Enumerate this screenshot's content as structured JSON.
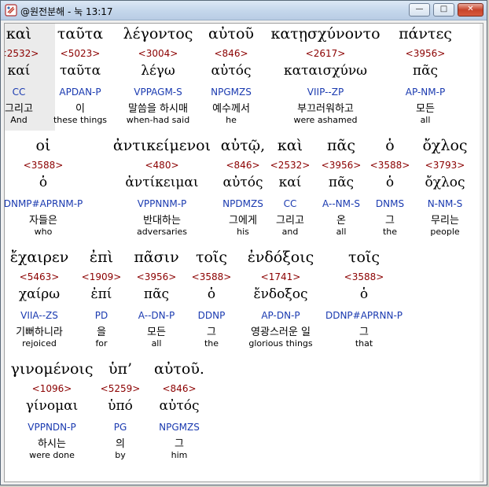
{
  "window": {
    "title": "@원전분해 - 눅 13:17"
  },
  "controls": {
    "minimize": "—",
    "maximize": "□",
    "close": "✕"
  },
  "rows": [
    {
      "words": [
        {
          "greek": "καὶ",
          "strong": "<2532>",
          "lemma": "καί",
          "parse": "CC",
          "korean": "그리고",
          "english": "And"
        },
        {
          "greek": "ταῦτα",
          "strong": "<5023>",
          "lemma": "ταῦτα",
          "parse": "APDAN-P",
          "korean": "이",
          "english": "these things"
        },
        {
          "greek": "λέγοντος",
          "strong": "<3004>",
          "lemma": "λέγω",
          "parse": "VPPAGM-S",
          "korean": "말씀을 하시매",
          "english": "when-had said"
        },
        {
          "greek": "αὐτοῦ",
          "strong": "<846>",
          "lemma": "αὐτός",
          "parse": "NPGMZS",
          "korean": "예수께서",
          "english": "he"
        },
        {
          "greek": "κατῃσχύνοντο",
          "strong": "<2617>",
          "lemma": "καταισχύνω",
          "parse": "VIIP--ZP",
          "korean": "부끄러워하고",
          "english": "were ashamed"
        },
        {
          "greek": "πάντες",
          "strong": "<3956>",
          "lemma": "πᾶς",
          "parse": "AP-NM-P",
          "korean": "모든",
          "english": "all"
        }
      ]
    },
    {
      "words": [
        {
          "greek": "οἱ",
          "strong": "<3588>",
          "lemma": "ὁ",
          "parse": "DNMP#APRNM-P",
          "korean": "자들은",
          "english": "who"
        },
        {
          "greek": "ἀντικείμενοι",
          "strong": "<480>",
          "lemma": "ἀντίκειμαι",
          "parse": "VPPNNM-P",
          "korean": "반대하는",
          "english": "adversaries"
        },
        {
          "greek": "αὐτῷ,",
          "strong": "<846>",
          "lemma": "αὐτός",
          "parse": "NPDMZS",
          "korean": "그에게",
          "english": "his"
        },
        {
          "greek": "καὶ",
          "strong": "<2532>",
          "lemma": "καί",
          "parse": "CC",
          "korean": "그리고",
          "english": "and"
        },
        {
          "greek": "πᾶς",
          "strong": "<3956>",
          "lemma": "πᾶς",
          "parse": "A--NM-S",
          "korean": "온",
          "english": "all"
        },
        {
          "greek": "ὁ",
          "strong": "<3588>",
          "lemma": "ὁ",
          "parse": "DNMS",
          "korean": "그",
          "english": "the"
        },
        {
          "greek": "ὄχλος",
          "strong": "<3793>",
          "lemma": "ὄχλος",
          "parse": "N-NM-S",
          "korean": "무리는",
          "english": "people"
        }
      ]
    },
    {
      "words": [
        {
          "greek": "ἔχαιρεν",
          "strong": "<5463>",
          "lemma": "χαίρω",
          "parse": "VIIA--ZS",
          "korean": "기뻐하니라",
          "english": "rejoiced"
        },
        {
          "greek": "ἐπὶ",
          "strong": "<1909>",
          "lemma": "ἐπί",
          "parse": "PD",
          "korean": "을",
          "english": "for"
        },
        {
          "greek": "πᾶσιν",
          "strong": "<3956>",
          "lemma": "πᾶς",
          "parse": "A--DN-P",
          "korean": "모든",
          "english": "all"
        },
        {
          "greek": "τοῖς",
          "strong": "<3588>",
          "lemma": "ὁ",
          "parse": "DDNP",
          "korean": "그",
          "english": "the"
        },
        {
          "greek": "ἐνδόξοις",
          "strong": "<1741>",
          "lemma": "ἔνδοξος",
          "parse": "AP-DN-P",
          "korean": "영광스러운 일",
          "english": "glorious things"
        },
        {
          "greek": "τοῖς",
          "strong": "<3588>",
          "lemma": "ὁ",
          "parse": "DDNP#APRNN-P",
          "korean": "그",
          "english": "that"
        }
      ]
    },
    {
      "words": [
        {
          "greek": "γινομένοις",
          "strong": "<1096>",
          "lemma": "γίνομαι",
          "parse": "VPPNDN-P",
          "korean": "하시는",
          "english": "were done"
        },
        {
          "greek": "ὑπ’",
          "strong": "<5259>",
          "lemma": "ὑπό",
          "parse": "PG",
          "korean": "의",
          "english": "by"
        },
        {
          "greek": "αὐτοῦ.",
          "strong": "<846>",
          "lemma": "αὐτός",
          "parse": "NPGMZS",
          "korean": "그",
          "english": "him"
        }
      ]
    }
  ]
}
